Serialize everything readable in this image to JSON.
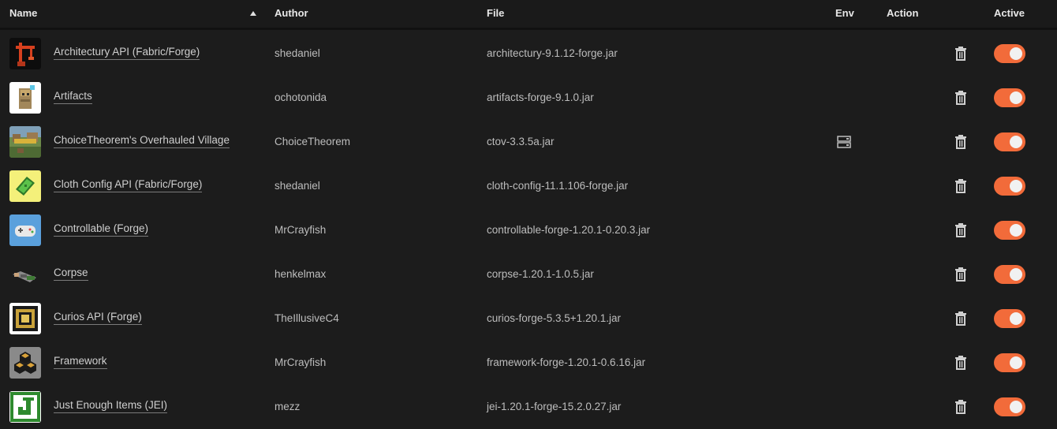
{
  "header": {
    "name": "Name",
    "author": "Author",
    "file": "File",
    "env": "Env",
    "action": "Action",
    "active": "Active"
  },
  "colors": {
    "accent": "#f26b3a",
    "background": "#1c1c1c"
  },
  "mods": [
    {
      "name": "Architectury API (Fabric/Forge)",
      "author": "shedaniel",
      "file": "architectury-9.1.12-forge.jar",
      "active": true,
      "env": false,
      "icon": "architectury-icon"
    },
    {
      "name": "Artifacts",
      "author": "ochotonida",
      "file": "artifacts-forge-9.1.0.jar",
      "active": true,
      "env": false,
      "icon": "artifacts-icon"
    },
    {
      "name": "ChoiceTheorem's Overhauled Village",
      "author": "ChoiceTheorem",
      "file": "ctov-3.3.5a.jar",
      "active": true,
      "env": true,
      "icon": "overhauled-village-icon"
    },
    {
      "name": "Cloth Config API (Fabric/Forge)",
      "author": "shedaniel",
      "file": "cloth-config-11.1.106-forge.jar",
      "active": true,
      "env": false,
      "icon": "cloth-config-icon"
    },
    {
      "name": "Controllable (Forge)",
      "author": "MrCrayfish",
      "file": "controllable-forge-1.20.1-0.20.3.jar",
      "active": true,
      "env": false,
      "icon": "controller-icon"
    },
    {
      "name": "Corpse",
      "author": "henkelmax",
      "file": "corpse-1.20.1-1.0.5.jar",
      "active": true,
      "env": false,
      "icon": "corpse-icon"
    },
    {
      "name": "Curios API (Forge)",
      "author": "TheIllusiveC4",
      "file": "curios-forge-5.3.5+1.20.1.jar",
      "active": true,
      "env": false,
      "icon": "curios-icon"
    },
    {
      "name": "Framework",
      "author": "MrCrayfish",
      "file": "framework-forge-1.20.1-0.6.16.jar",
      "active": true,
      "env": false,
      "icon": "framework-icon"
    },
    {
      "name": "Just Enough Items (JEI)",
      "author": "mezz",
      "file": "jei-1.20.1-forge-15.2.0.27.jar",
      "active": true,
      "env": false,
      "icon": "jei-icon"
    }
  ]
}
